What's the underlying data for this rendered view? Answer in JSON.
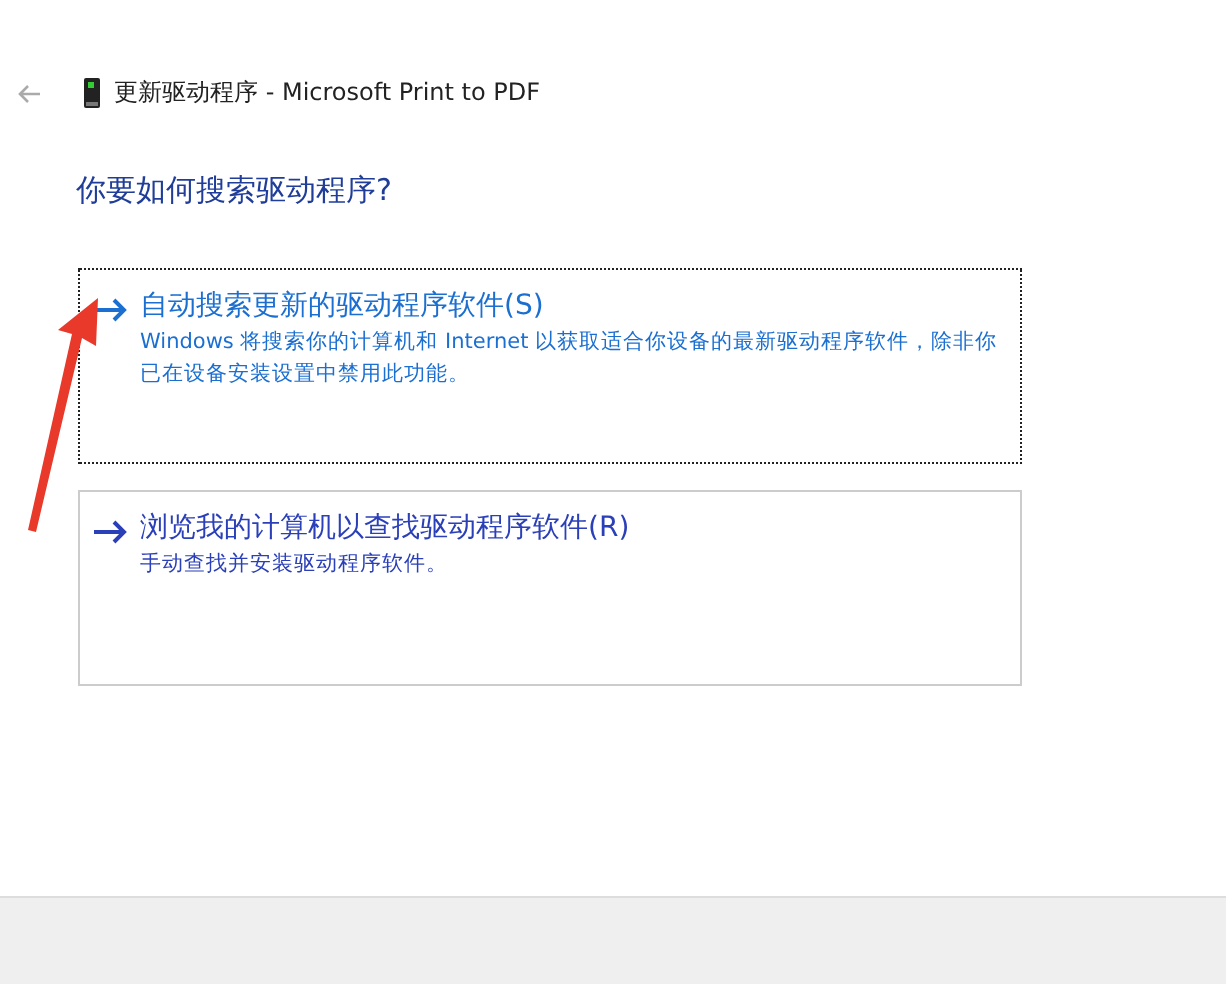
{
  "window": {
    "title": "更新驱动程序 - Microsoft Print to PDF",
    "back_disabled": true
  },
  "heading": "你要如何搜索驱动程序?",
  "options": [
    {
      "title": "自动搜索更新的驱动程序软件(S)",
      "description": "Windows 将搜索你的计算机和 Internet 以获取适合你设备的最新驱动程序软件，除非你已在设备安装设置中禁用此功能。",
      "selected": true
    },
    {
      "title": "浏览我的计算机以查找驱动程序软件(R)",
      "description": "手动查找并安装驱动程序软件。",
      "selected": false
    }
  ]
}
